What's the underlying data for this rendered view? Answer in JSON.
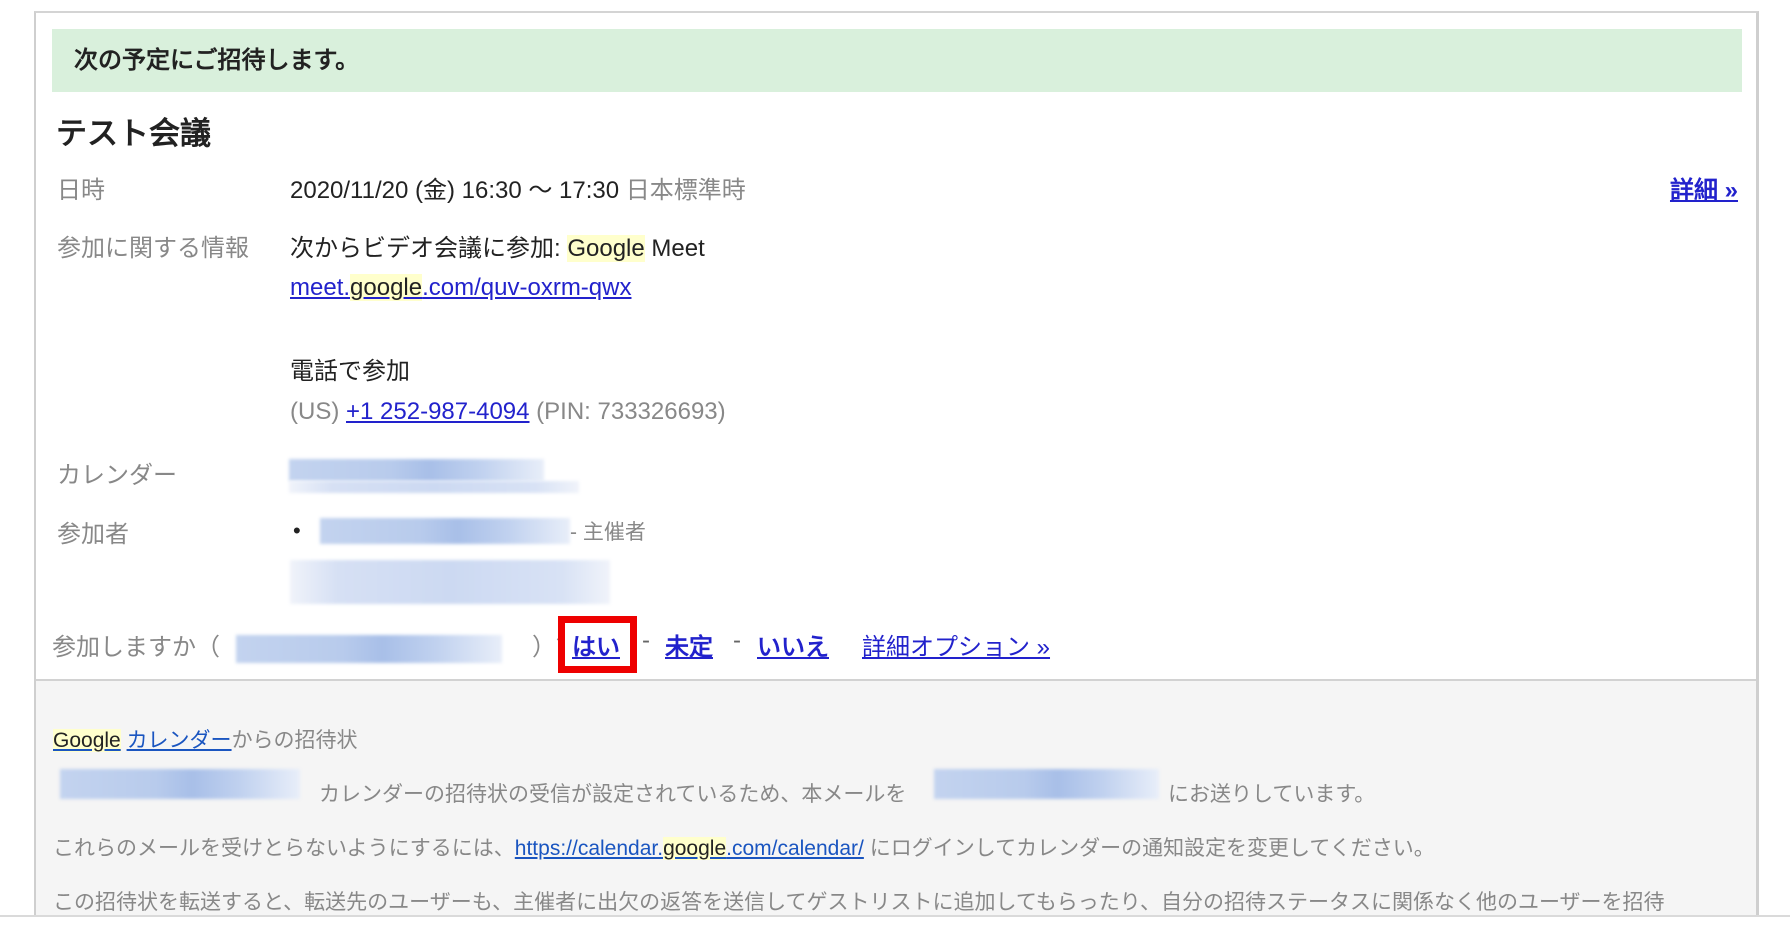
{
  "banner": {
    "text": "次の予定にご招待します。",
    "color": "#d9f0dc"
  },
  "event": {
    "title": "テスト会議",
    "details_link": "詳細 »",
    "rows": {
      "datetime": {
        "label": "日時",
        "value": "2020/11/20 (金) 16:30 〜 17:30",
        "timezone": "日本標準時"
      },
      "join_info": {
        "label": "参加に関する情報",
        "video_prefix": "次からビデオ会議に参加: ",
        "video_highlight": "Google",
        "video_suffix": " Meet",
        "meet_link_pre": "meet.",
        "meet_link_hl": "google",
        "meet_link_post": ".com/quv-oxrm-qwx",
        "phone_heading": "電話で参加",
        "phone_country": "(US) ",
        "phone_number": "+1 252-987-4094",
        "phone_pin": " (PIN: 733326693)"
      },
      "calendar": {
        "label": "カレンダー",
        "value_redacted": true
      },
      "guests": {
        "label": "参加者",
        "items": [
          {
            "name_redacted": true,
            "role": "- 主催者"
          },
          {
            "name_redacted": true,
            "role": ""
          }
        ]
      }
    }
  },
  "rsvp": {
    "prompt": "参加しますか（",
    "prompt_close": "）？",
    "yes": "はい",
    "sep": "-",
    "maybe": "未定",
    "no": "いいえ",
    "more_options": "詳細オプション »",
    "highlight_color": "#ee0000"
  },
  "footer": {
    "line1_google": "Google",
    "line1_calendar_link": "カレンダー",
    "line1_suffix": "からの招待状",
    "line2_text": "カレンダーの招待状の受信が設定されているため、本メールを",
    "line2_suffix": "にお送りしています。",
    "line3_prefix": "これらのメールを受けとらないようにするには、",
    "line3_link_pre": "https://calendar.",
    "line3_link_hl": "google",
    "line3_link_post": ".com/calendar/",
    "line3_suffix": " にログインしてカレンダーの通知設定を変更してください。",
    "line4_text": "この招待状を転送すると、転送先のユーザーも、主催者に出欠の返答を送信してゲストリストに追加してもらったり、自分の招待ステータスに関係なく他のユーザーを招待"
  },
  "colors": {
    "link": "#2222cc",
    "footer_link": "#1a55c0",
    "label": "#888888",
    "highlight": "#ffffcc"
  }
}
